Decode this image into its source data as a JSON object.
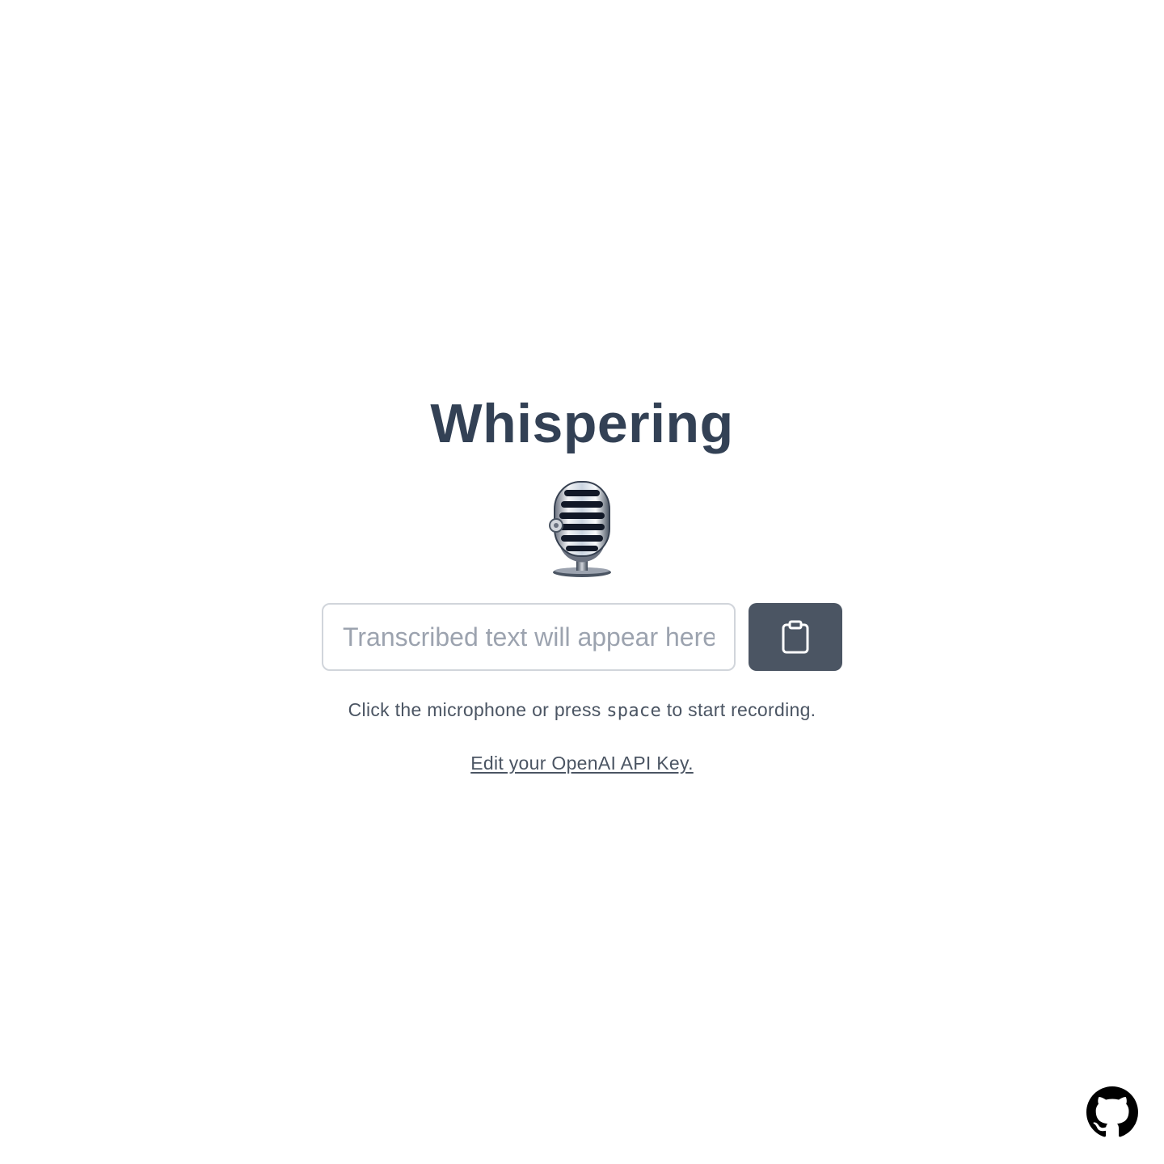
{
  "app": {
    "title": "Whispering"
  },
  "recorder": {
    "icon": "studio-microphone-icon"
  },
  "transcript": {
    "value": "",
    "placeholder": "Transcribed text will appear here..."
  },
  "copy_button": {
    "icon": "clipboard-icon",
    "color": "#4b5563"
  },
  "instructions": {
    "before": "Click the microphone or press ",
    "key": "space",
    "after": " to start recording."
  },
  "api_key_link": {
    "label": "Edit your OpenAI API Key."
  },
  "github": {
    "icon": "github-icon"
  },
  "colors": {
    "title": "#334155",
    "text": "#4b5563",
    "input_border": "#d1d5db",
    "placeholder": "#9ca3af"
  }
}
